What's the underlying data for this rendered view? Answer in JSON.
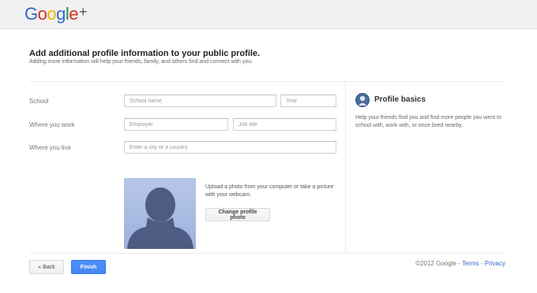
{
  "header": {
    "logo_letters": [
      "G",
      "o",
      "o",
      "g",
      "l",
      "e"
    ],
    "logo_plus": "+"
  },
  "intro": {
    "title": "Add additional profile information to your public profile.",
    "subtitle": "Adding more information will help your friends, family, and others find and connect with you."
  },
  "form": {
    "school": {
      "label": "School",
      "name_placeholder": "School name",
      "year_placeholder": "Year"
    },
    "work": {
      "label": "Where you work",
      "employer_placeholder": "Employer",
      "job_placeholder": "Job title"
    },
    "live": {
      "label": "Where you live",
      "city_placeholder": "Enter a city or a country"
    }
  },
  "photo": {
    "instructions": "Upload a photo from your computer or take a picture with your webcam.",
    "change_button": "Change profile photo"
  },
  "sidebar": {
    "title": "Profile basics",
    "text": "Help your friends find you and find more people you went to school with, work with, or once lived nearby."
  },
  "actions": {
    "back_label": "« Back",
    "finish_label": "Finish"
  },
  "footer": {
    "copyright": "©2012 Google",
    "sep1": " - ",
    "terms": "Terms",
    "sep2": " - ",
    "privacy": "Privacy"
  },
  "colors": {
    "accent_blue": "#4d90fe",
    "link_blue": "#3366cc",
    "photo_bg": "#a7b8e0"
  }
}
